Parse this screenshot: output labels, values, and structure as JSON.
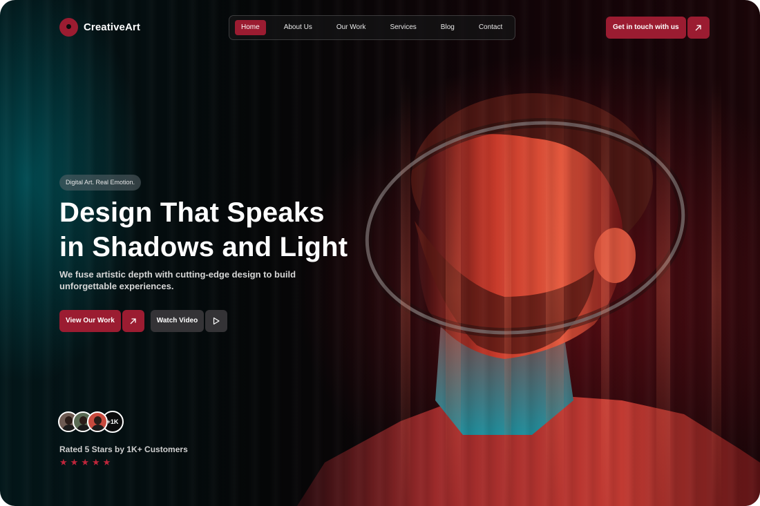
{
  "header": {
    "logo_text": "CreativeArt",
    "nav": [
      {
        "label": "Home",
        "active": true
      },
      {
        "label": "About Us",
        "active": false
      },
      {
        "label": "Our Work",
        "active": false
      },
      {
        "label": "Services",
        "active": false
      },
      {
        "label": "Blog",
        "active": false
      },
      {
        "label": "Contact",
        "active": false
      }
    ],
    "cta_label": "Get in touch with us",
    "cta_icon": "arrow-up-right-icon"
  },
  "hero": {
    "badge": "Digital Art. Real Emotion.",
    "title_line1": "Design That Speaks",
    "title_line2": "in Shadows and Light",
    "subtitle": "We fuse artistic depth with cutting-edge design to build unforgettable experiences.",
    "primary_button": {
      "label": "View Our Work",
      "icon": "arrow-up-right-icon"
    },
    "secondary_button": {
      "label": "Watch Video",
      "icon": "play-icon"
    }
  },
  "social_proof": {
    "avatar_count_label": "+1K",
    "rating_text": "Rated 5 Stars by 1K+ Customers",
    "stars": 5
  },
  "colors": {
    "accent": "#9b1c31",
    "background": "#050607",
    "teal_glow": "#007882",
    "red_glow": "#96141e"
  }
}
